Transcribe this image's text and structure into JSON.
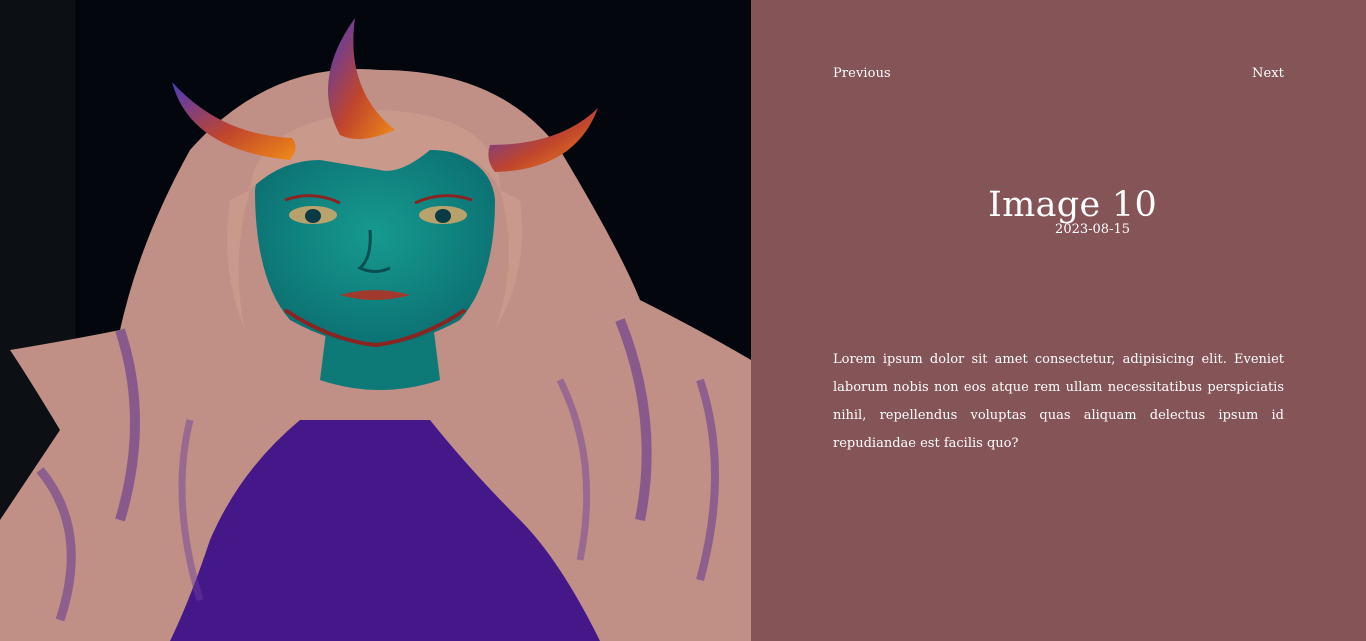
{
  "colors": {
    "panel_background": "#845456",
    "text": "#ffffff",
    "artwork_background": "#03060c"
  },
  "artwork": {
    "alt": "Illustration of a figure with horns, teal skin and long pale wavy hair",
    "icon": "artwork-image"
  },
  "nav": {
    "previous_label": "Previous",
    "next_label": "Next"
  },
  "image": {
    "title": "Image 10",
    "date": "2023-08-15",
    "description": "Lorem ipsum dolor sit amet consectetur, adipisicing elit. Eveniet laborum nobis non eos atque rem ullam necessitatibus perspiciatis nihil, repellendus voluptas quas aliquam delectus ipsum id repudiandae est facilis quo?"
  }
}
